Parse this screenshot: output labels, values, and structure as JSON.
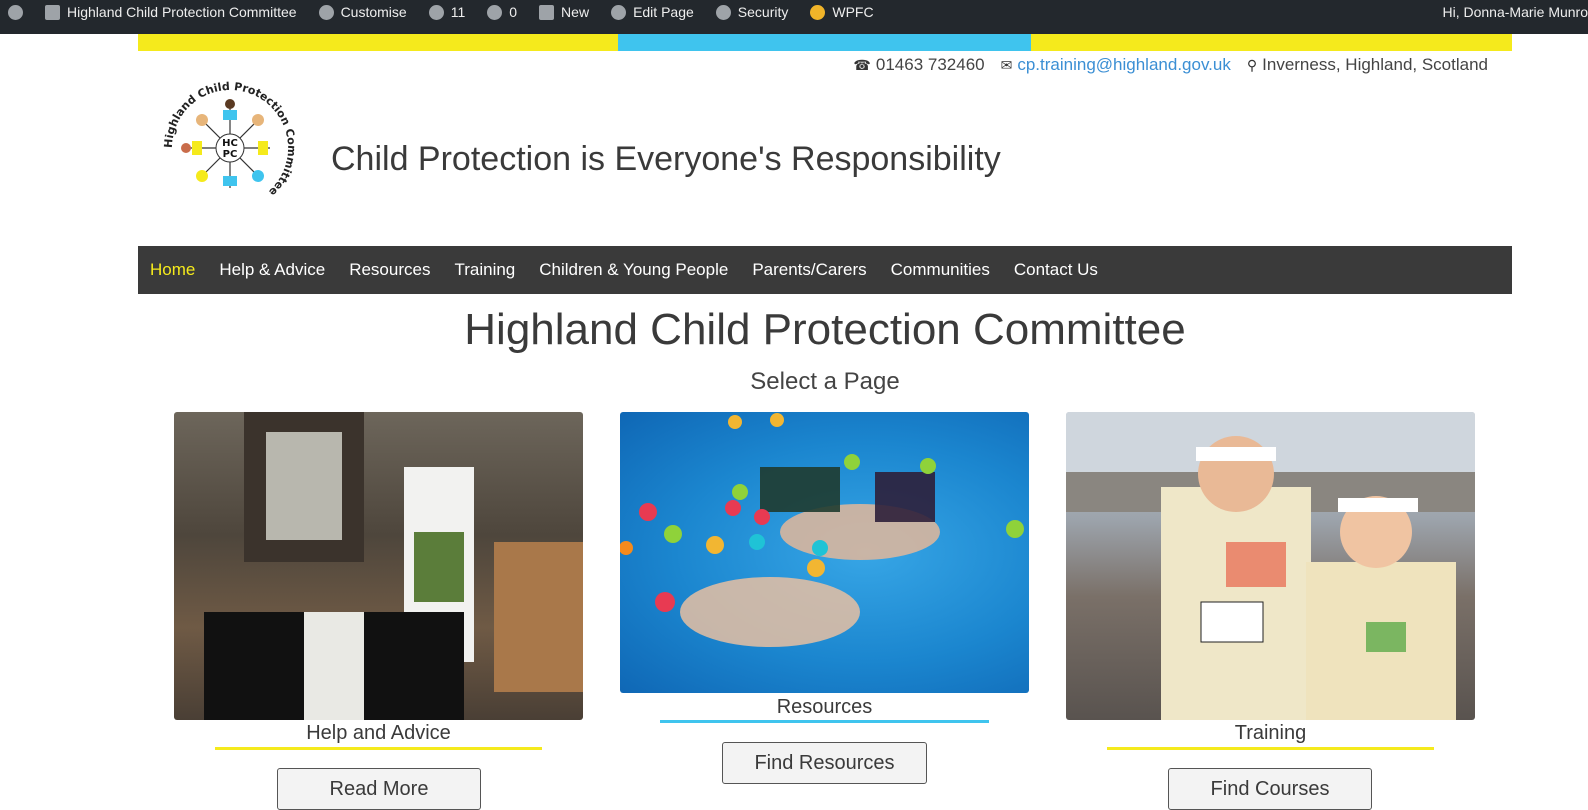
{
  "admin_bar": {
    "site_name": "Highland Child Protection Committee",
    "customise": "Customise",
    "updates_count": "11",
    "comments_count": "0",
    "new": "New",
    "edit_page": "Edit Page",
    "security": "Security",
    "plugin": "WPFC",
    "greeting": "Hi, Donna-Marie Munro"
  },
  "contact": {
    "phone": "01463 732460",
    "email": "cp.training@highland.gov.uk",
    "location": "Inverness, Highland, Scotland"
  },
  "logo": {
    "ring_text": "Highland Child Protection Committee",
    "center_line1": "HC",
    "center_line2": "PC"
  },
  "tagline": "Child Protection is Everyone's Responsibility",
  "nav": [
    {
      "label": "Home",
      "active": true
    },
    {
      "label": "Help & Advice"
    },
    {
      "label": "Resources"
    },
    {
      "label": "Training"
    },
    {
      "label": "Children & Young People"
    },
    {
      "label": "Parents/Carers"
    },
    {
      "label": "Communities"
    },
    {
      "label": "Contact Us"
    }
  ],
  "page_title": "Highland Child Protection Committee",
  "subtitle": "Select a Page",
  "cards": [
    {
      "title": "Help and Advice",
      "button": "Read More",
      "underline_color": "#f5ea1c"
    },
    {
      "title": "Resources",
      "button": "Find Resources",
      "underline_color": "#3fc4ee"
    },
    {
      "title": "Training",
      "button": "Find Courses",
      "underline_color": "#f5ea1c"
    }
  ],
  "colors": {
    "yellow": "#f5ea1c",
    "blue": "#3fc4ee",
    "nav_bg": "#3a3a3a",
    "admin_bg": "#23282d"
  }
}
